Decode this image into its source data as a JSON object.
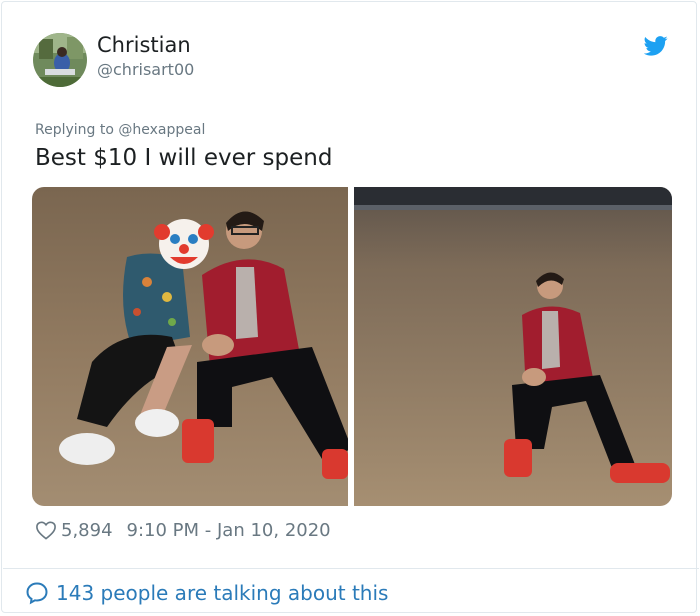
{
  "tweet": {
    "author_name": "Christian",
    "author_handle": "@chrisart00",
    "replying_prefix": "Replying to",
    "replying_handle": "@hexappeal",
    "text": "Best $10 I will ever spend",
    "likes": "5,894",
    "timestamp": "9:10 PM - Jan 10, 2020",
    "conversation_text": "143 people are talking about this"
  },
  "icons": {
    "brand": "twitter-bird-icon",
    "like": "heart-icon",
    "reply": "speech-bubble-icon"
  },
  "colors": {
    "twitter_blue": "#1da1f2",
    "link_blue": "#2b7bb9",
    "meta_gray": "#697882",
    "text_dark": "#1c2022"
  }
}
